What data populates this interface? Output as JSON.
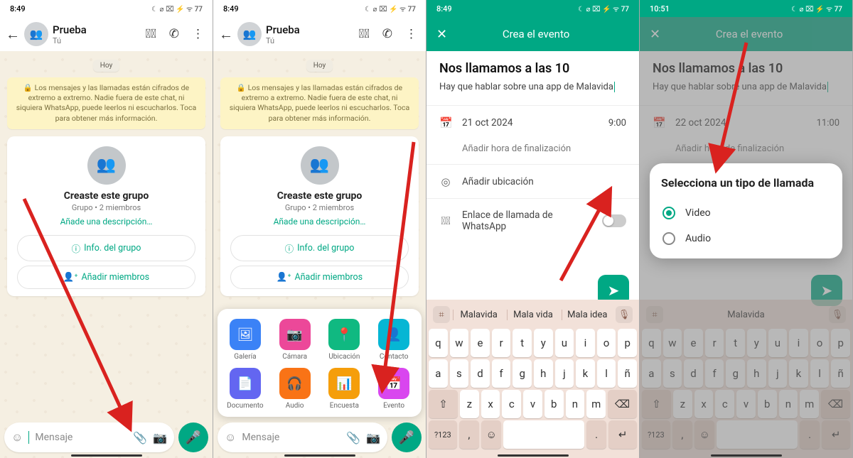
{
  "status": {
    "time_a": "8:49",
    "time_b": "10:51",
    "icons": "☾ ⌀ ⌧ ⚡ ᯤ 77"
  },
  "chat": {
    "name": "Prueba",
    "sub": "Tú",
    "date": "Hoy",
    "encryption": "🔒 Los mensajes y las llamadas están cifrados de extremo a extremo. Nadie fuera de este chat, ni siquiera WhatsApp, puede leerlos ni escucharlos. Toca para obtener más información.",
    "group_created": "Creaste este grupo",
    "group_meta": "Grupo • 2 miembros",
    "add_desc": "Añade una descripción…",
    "info_btn": "Info. del grupo",
    "add_btn": "Añadir miembros",
    "input_placeholder": "Mensaje"
  },
  "sheet": {
    "gallery": "Galería",
    "camera": "Cámara",
    "location": "Ubicación",
    "contact": "Contacto",
    "document": "Documento",
    "audio": "Audio",
    "poll": "Encuesta",
    "event": "Evento"
  },
  "event": {
    "header": "Crea el evento",
    "title": "Nos llamamos a las 10",
    "desc": "Hay que hablar sobre una app de Malavida",
    "date_a": "21 oct 2024",
    "time_a_val": "9:00",
    "date_b": "22 oct 2024",
    "time_b_val": "11:00",
    "end_time": "Añadir hora de finalización",
    "location": "Añadir ubicación",
    "call_link": "Enlace de llamada de WhatsApp"
  },
  "kbd": {
    "s1": "Malavida",
    "s2": "Mala vida",
    "s3": "Mala idea",
    "s_single": "Malavida",
    "row1": [
      "q",
      "w",
      "e",
      "r",
      "t",
      "y",
      "u",
      "i",
      "o",
      "p"
    ],
    "row2": [
      "a",
      "s",
      "d",
      "f",
      "g",
      "h",
      "j",
      "k",
      "l",
      "ñ"
    ],
    "row3": [
      "z",
      "x",
      "c",
      "v",
      "b",
      "n",
      "m"
    ],
    "num": "?123",
    "enter": "↵"
  },
  "popup": {
    "title": "Selecciona un tipo de llamada",
    "video": "Video",
    "audio": "Audio"
  }
}
